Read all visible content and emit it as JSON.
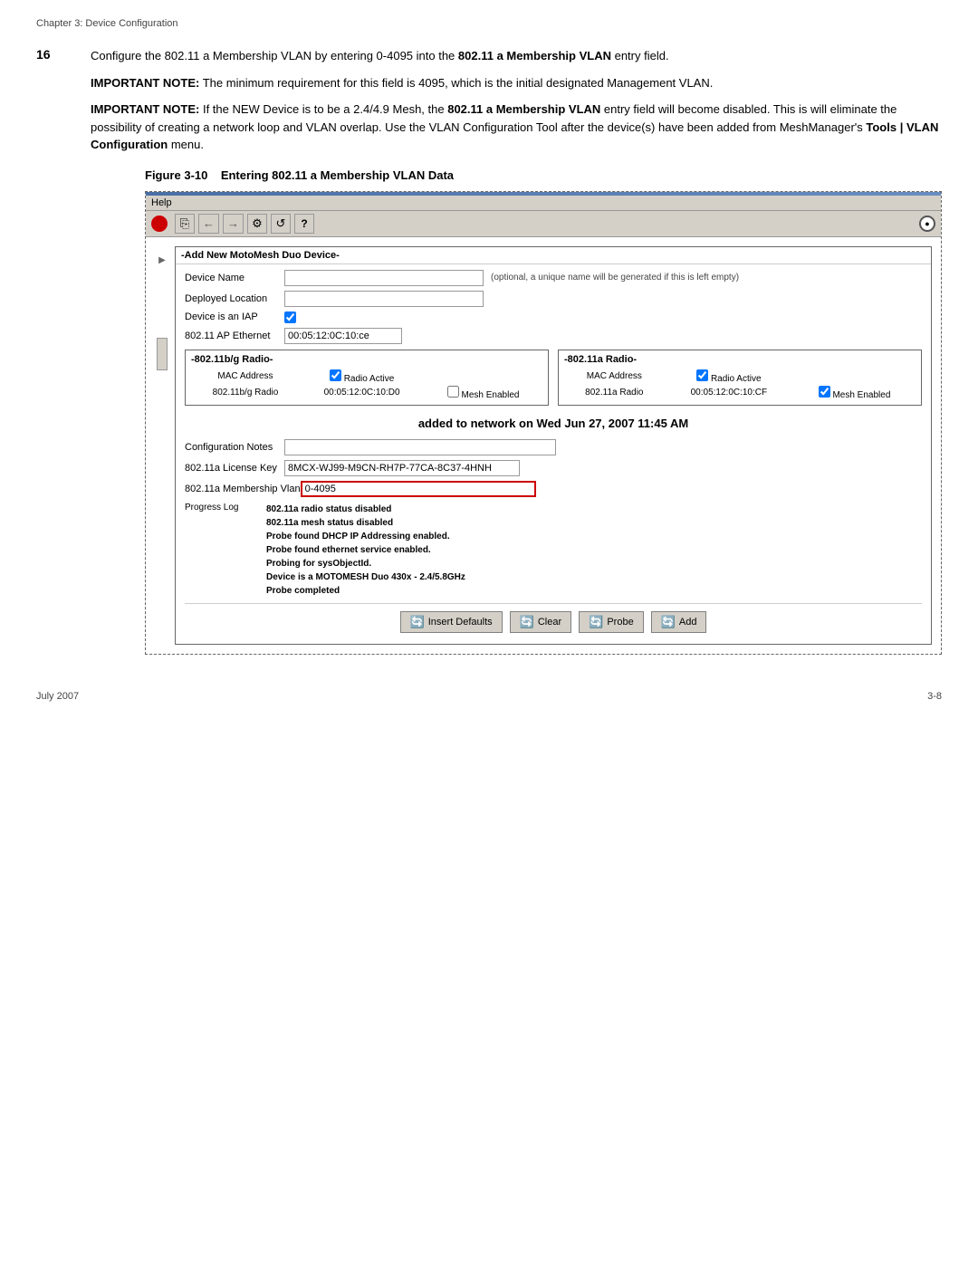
{
  "chapter_header": "Chapter 3: Device Configuration",
  "step": {
    "number": "16",
    "paragraphs": [
      "Configure the 802.11 a Membership VLAN by entering 0-4095 into the 802.11 a Membership VLAN entry field.",
      "IMPORTANT NOTE: The minimum requirement for this field is 4095, which is the initial designated Management VLAN.",
      "IMPORTANT NOTE: If the NEW Device is to be a 2.4/4.9 Mesh, the 802.11 a Membership VLAN entry field will become disabled. This is will eliminate the possibility of creating a network loop and VLAN overlap. Use the VLAN Configuration Tool after the device(s) have been added from MeshManager’s Tools | VLAN Configuration menu."
    ]
  },
  "figure": {
    "number": "Figure 3-10",
    "caption": "Entering 802.11 a Membership VLAN Data"
  },
  "app": {
    "menu": "Help",
    "toolbar_icons": [
      "copy",
      "back",
      "forward",
      "settings",
      "refresh",
      "question",
      "circle"
    ],
    "panel_title": "Add New MotoMesh Duo Device",
    "form": {
      "device_name_label": "Device Name",
      "device_name_hint": "(optional, a unique name will be generated if this is left empty)",
      "deployed_location_label": "Deployed Location",
      "device_is_iap_label": "Device is an IAP",
      "ap_ethernet_label": "802.11 AP Ethernet",
      "ap_ethernet_value": "00:05:12:0C:10:ce",
      "radio_bg_title": "-802.11b/g Radio-",
      "radio_bg_mac_label": "MAC Address",
      "radio_bg_radio_active": "Radio Active",
      "radio_bg_mac_value": "802.11b/g Radio",
      "radio_bg_mac_address": "00:05:12:0C:10:D0",
      "radio_bg_mesh_enabled": "Mesh Enabled",
      "radio_a_title": "-802.11a Radio-",
      "radio_a_mac_label": "MAC Address",
      "radio_a_radio_active": "Radio Active",
      "radio_a_mac_value": "802.11a Radio",
      "radio_a_mac_address": "00:05:12:0C:10:CF",
      "radio_a_mesh_enabled": "Mesh Enabled",
      "status_message": "added to network on Wed Jun 27, 2007 11:45 AM",
      "config_notes_label": "Configuration Notes",
      "license_key_label": "802.11a License Key",
      "license_key_value": "8MCX-WJ99-M9CN-RH7P-77CA-8C37-4HNH",
      "membership_vlan_label": "802.11a Membership Vlan",
      "membership_vlan_value": "0-4095",
      "progress_log_label": "Progress Log",
      "progress_log_lines": [
        "802.11a radio status disabled",
        "802.11a mesh status disabled",
        "Probe found DHCP IP Addressing enabled.",
        "Probe found ethernet service enabled.",
        "Probing for sysObjectId.",
        "Device is a MOTOMESH Duo 430x - 2.4/5.8GHz",
        "Probe completed"
      ],
      "buttons": {
        "insert_defaults": "Insert Defaults",
        "clear": "Clear",
        "probe": "Probe",
        "add": "Add"
      }
    }
  },
  "footer": {
    "left": "July 2007",
    "right": "3-8"
  }
}
